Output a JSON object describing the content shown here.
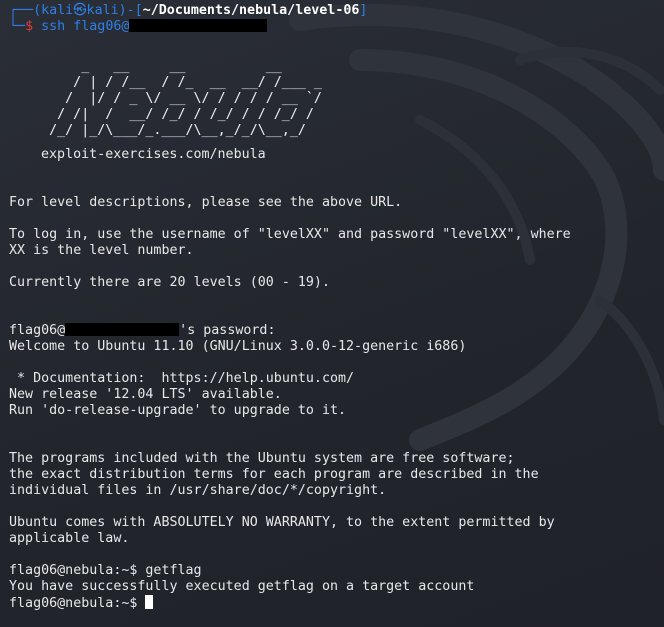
{
  "prompt": {
    "user": "kali",
    "at_symbol": "㉿",
    "host": "kali",
    "path": "~/Documents/nebula/level-06",
    "command": "ssh flag06@"
  },
  "banner": [
    "        _   __     __          __",
    "       / | / /__  / /_  __  __/ /___ _",
    "      /  |/ / _ \\/ __ \\/ / / / / __ `/",
    "     / /|  /  __/ /_/ / /_/ / / /_/ /",
    "    /_/ |_/\\___/_.___/\\__,_/_/\\__,_/"
  ],
  "banner_url": "exploit-exercises.com/nebula",
  "intro": {
    "level_desc": "For level descriptions, please see the above URL.",
    "login_1": "To log in, use the username of \"levelXX\" and password \"levelXX\", where",
    "login_2": "XX is the level number.",
    "levels": "Currently there are 20 levels (00 - 19)."
  },
  "password": {
    "prefix": "flag06@",
    "suffix": "'s password:"
  },
  "welcome": "Welcome to Ubuntu 11.10 (GNU/Linux 3.0.0-12-generic i686)",
  "docs": " * Documentation:  https://help.ubuntu.com/",
  "release_1": "New release '12.04 LTS' available.",
  "release_2": "Run 'do-release-upgrade' to upgrade to it.",
  "free_1": "The programs included with the Ubuntu system are free software;",
  "free_2": "the exact distribution terms for each program are described in the",
  "free_3": "individual files in /usr/share/doc/*/copyright.",
  "warranty_1": "Ubuntu comes with ABSOLUTELY NO WARRANTY, to the extent permitted by",
  "warranty_2": "applicable law.",
  "session": {
    "prompt1": "flag06@nebula:~$ getflag",
    "output": "You have successfully executed getflag on a target account",
    "prompt2": "flag06@nebula:~$ "
  },
  "colors": {
    "background": "#24272f",
    "prompt_blue": "#2f7fe6",
    "prompt_red": "#e33b3b",
    "text": "#e8e8e8"
  }
}
